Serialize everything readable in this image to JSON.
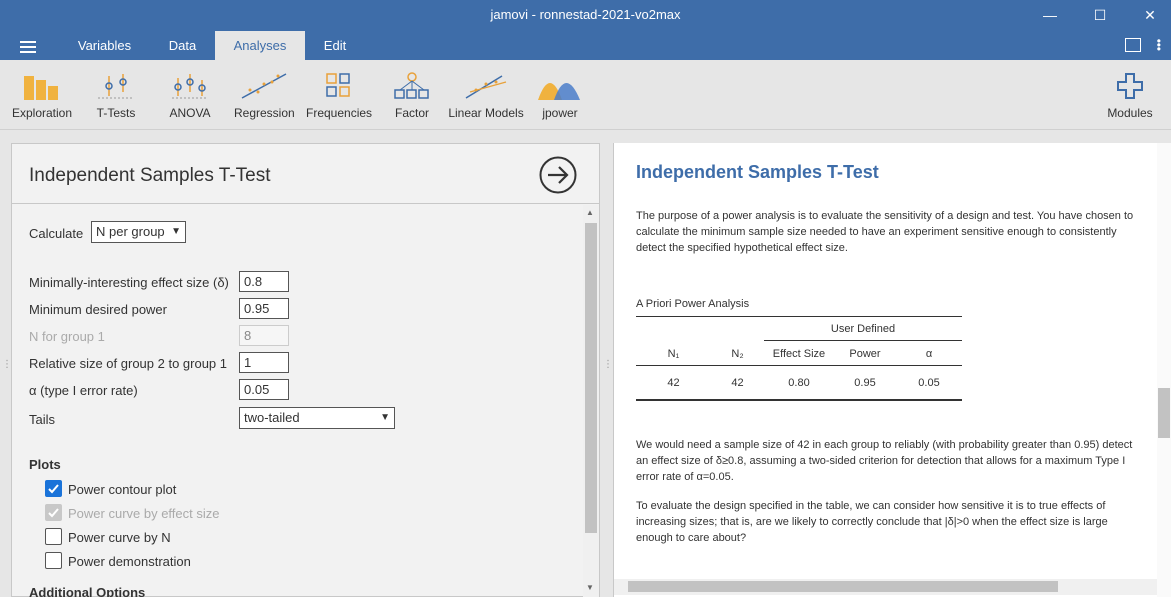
{
  "window": {
    "title": "jamovi - ronnestad-2021-vo2max"
  },
  "menubar": {
    "tabs": [
      {
        "label": "Variables"
      },
      {
        "label": "Data"
      },
      {
        "label": "Analyses"
      },
      {
        "label": "Edit"
      }
    ],
    "active_tab": "Analyses"
  },
  "toolbar": {
    "items": [
      {
        "label": "Exploration",
        "icon": "exploration-icon"
      },
      {
        "label": "T-Tests",
        "icon": "ttests-icon"
      },
      {
        "label": "ANOVA",
        "icon": "anova-icon"
      },
      {
        "label": "Regression",
        "icon": "regression-icon"
      },
      {
        "label": "Frequencies",
        "icon": "frequencies-icon"
      },
      {
        "label": "Factor",
        "icon": "factor-icon"
      },
      {
        "label": "Linear Models",
        "icon": "linear-models-icon"
      },
      {
        "label": "jpower",
        "icon": "jpower-icon"
      },
      {
        "label": "Modules",
        "icon": "modules-icon"
      }
    ]
  },
  "options_panel": {
    "title": "Independent Samples T-Test",
    "calculate": {
      "label": "Calculate",
      "value": "N per group"
    },
    "effect_size": {
      "label": "Minimally-interesting effect size (δ)",
      "value": "0.8"
    },
    "power": {
      "label": "Minimum desired power",
      "value": "0.95"
    },
    "n_group1": {
      "label": "N for group 1",
      "value": "8"
    },
    "ratio": {
      "label": "Relative size of group 2 to group 1",
      "value": "1"
    },
    "alpha": {
      "label": "α (type I error rate)",
      "value": "0.05"
    },
    "tails": {
      "label": "Tails",
      "value": "two-tailed"
    },
    "plots": {
      "title": "Plots",
      "items": [
        {
          "label": "Power contour plot",
          "checked": true,
          "enabled": true
        },
        {
          "label": "Power curve by effect size",
          "checked": true,
          "enabled": false
        },
        {
          "label": "Power curve by N",
          "checked": false,
          "enabled": true
        },
        {
          "label": "Power demonstration",
          "checked": false,
          "enabled": true
        }
      ]
    },
    "additional_options": "Additional Options"
  },
  "results": {
    "title": "Independent Samples T-Test",
    "intro": "The purpose of a power analysis is to evaluate the sensitivity of a design and test. You have chosen to calculate the minimum sample size needed to have an experiment sensitive enough to consistently detect the specified hypothetical effect size.",
    "table": {
      "title": "A Priori Power Analysis",
      "group_header": "User Defined",
      "columns": [
        "N₁",
        "N₂",
        "Effect Size",
        "Power",
        "α"
      ],
      "rows": [
        [
          "42",
          "42",
          "0.80",
          "0.95",
          "0.05"
        ]
      ]
    },
    "para1": "We would need a sample size of 42 in each group to reliably (with probability greater than 0.95) detect an effect size of δ≥0.8, assuming a two-sided criterion for detection that allows for a maximum Type I error rate of α=0.05.",
    "para2": "To evaluate the design specified in the table, we can consider how sensitive it is to true effects of increasing sizes; that is, are we likely to correctly conclude that |δ|>0 when the effect size is large enough to care about?"
  },
  "colors": {
    "brand": "#3e6da9",
    "checkbox": "#1a73d9"
  }
}
